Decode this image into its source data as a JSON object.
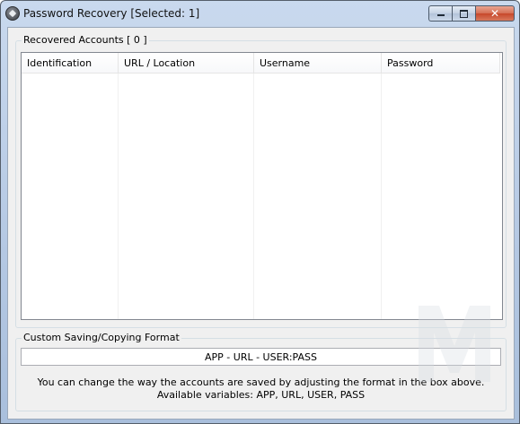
{
  "window": {
    "title": "Password Recovery [Selected: 1]"
  },
  "recovered_group": {
    "label": "Recovered Accounts [ 0 ]",
    "columns": [
      "Identification",
      "URL / Location",
      "Username",
      "Password"
    ],
    "rows": []
  },
  "format_group": {
    "label": "Custom Saving/Copying Format",
    "format_value": "APP - URL - USER:PASS",
    "hint_line1": "You can change the way the accounts are saved by adjusting the format in the box above.",
    "hint_line2": "Available variables: APP, URL, USER, PASS"
  },
  "icons": {
    "app": "app-icon",
    "minimize": "minimize-icon",
    "maximize": "maximize-icon",
    "close": "close-icon"
  },
  "colors": {
    "titlebar": "#b4c8e3",
    "client_bg": "#f0f0f0",
    "close_button": "#c7472a"
  }
}
